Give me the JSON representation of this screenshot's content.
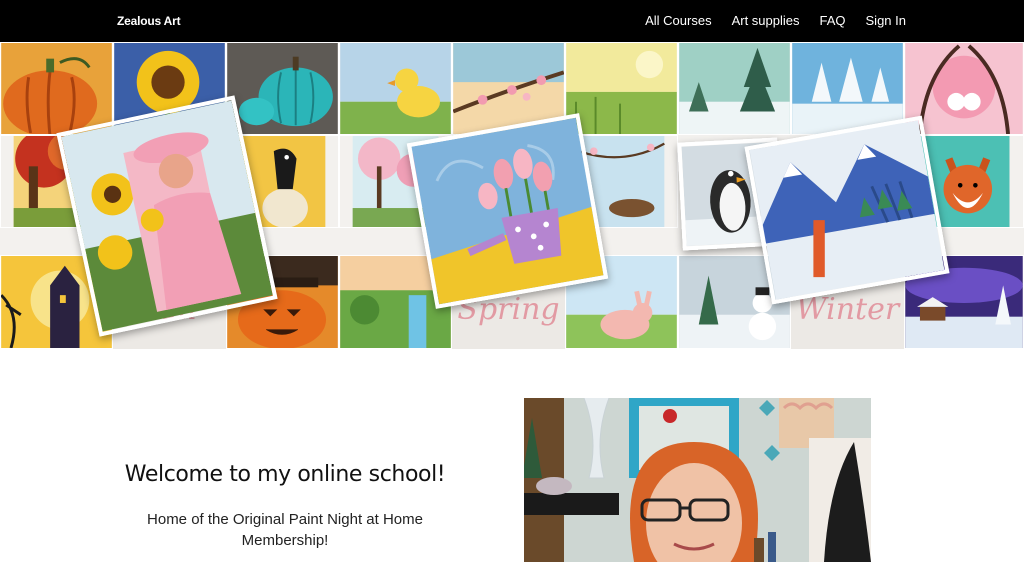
{
  "header": {
    "brand": "Zealous Art",
    "nav": [
      {
        "label": "All Courses"
      },
      {
        "label": "Art supplies"
      },
      {
        "label": "FAQ"
      },
      {
        "label": "Sign In"
      }
    ]
  },
  "banner": {
    "season_labels": {
      "fall": "Fall",
      "spring": "Spring",
      "winter": "Winter"
    },
    "paintings": [
      "pumpkin-painting",
      "sunflower-painting",
      "teal-pumpkin-painting",
      "duckling-painting",
      "blossom-branch-painting",
      "meadow-painting",
      "snowy-trees-painting",
      "winter-forest-painting",
      "gnome-couple-painting",
      "autumn-tree-painting",
      "crow-pumpkin-painting",
      "cherry-tree-painting",
      "nest-painting",
      "fox-painting",
      "haunted-house-painting",
      "scarecrow-painting",
      "waterfall-painting",
      "bunny-painting",
      "snowman-painting",
      "night-cabin-painting",
      "sunflower-girl-painting",
      "tulip-watering-can-painting",
      "penguin-painting",
      "mountain-ski-painting"
    ]
  },
  "main": {
    "welcome_title": "Welcome to my online school!",
    "welcome_subtitle": "Home of the Original Paint Night at Home Membership!",
    "instructor_photo": "instructor-photo"
  },
  "colors": {
    "topbar": "#000000",
    "season_text": "#e29aa3",
    "background": "#ffffff"
  }
}
